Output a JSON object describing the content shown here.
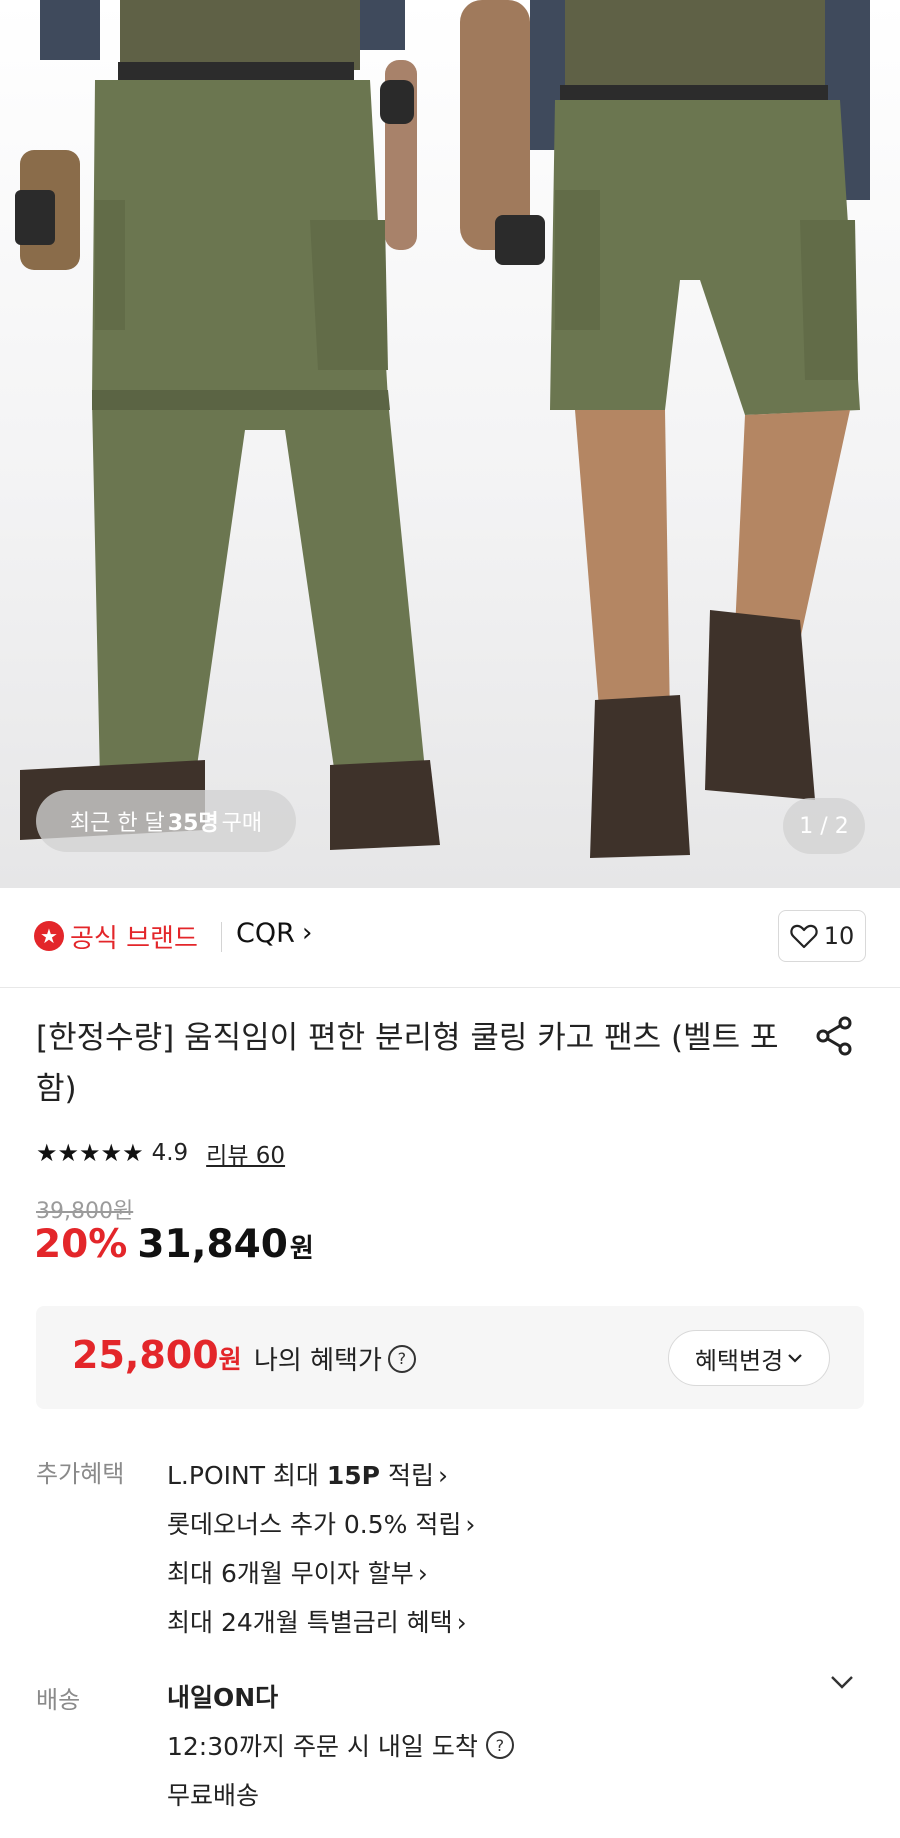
{
  "hero": {
    "buyers_prefix": "최근 한 달",
    "buyers_count": "35명",
    "buyers_suffix": "구매",
    "pager": "1 / 2"
  },
  "brand": {
    "official_label": "공식 브랜드",
    "name": "CQR",
    "chevron": "›",
    "likes": "10"
  },
  "product": {
    "title": "[한정수량] 움직임이 편한 분리형 쿨링 카고 팬츠 (벨트 포함)",
    "stars": "★★★★★",
    "rating": "4.9",
    "review_label": "리뷰 60",
    "original_price": "39,800원",
    "discount_pct": "20%",
    "price": "31,840",
    "won": "원"
  },
  "benefit": {
    "price": "25,800",
    "won": "원",
    "label": "나의 혜택가",
    "help": "?",
    "change_label": "혜택변경"
  },
  "extra_benefits": {
    "label": "추가혜택",
    "items": [
      {
        "pre": "L.POINT 최대 ",
        "bold": "15P",
        "post": " 적립"
      },
      {
        "pre": "롯데오너스 추가 0.5% 적립",
        "bold": "",
        "post": ""
      },
      {
        "pre": "최대 6개월 무이자 할부",
        "bold": "",
        "post": ""
      },
      {
        "pre": "최대 24개월 특별금리 혜택",
        "bold": "",
        "post": ""
      }
    ]
  },
  "delivery": {
    "label": "배송",
    "title": "내일ON다",
    "cutoff": "12:30까지 주문 시 내일 도착",
    "help": "?",
    "fee": "무료배송"
  },
  "colors": {
    "accent_red": "#e3262a",
    "pants_green": "#6b7650",
    "boot_brown": "#3e322a"
  },
  "icons": [
    "star-badge-icon",
    "heart-icon",
    "share-icon",
    "help-icon",
    "chevron-down-icon",
    "chevron-right-icon"
  ]
}
